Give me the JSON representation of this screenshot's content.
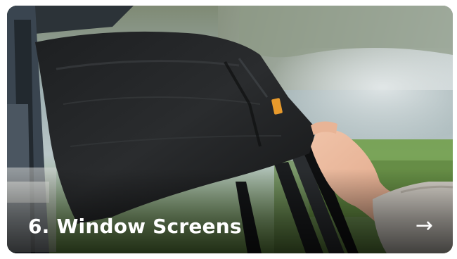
{
  "card": {
    "title": "6. Window Screens",
    "arrow_icon": "arrow-right-icon",
    "arrow_glyph": "→",
    "image_subject": "black mesh window sock being pulled over a car door window"
  }
}
